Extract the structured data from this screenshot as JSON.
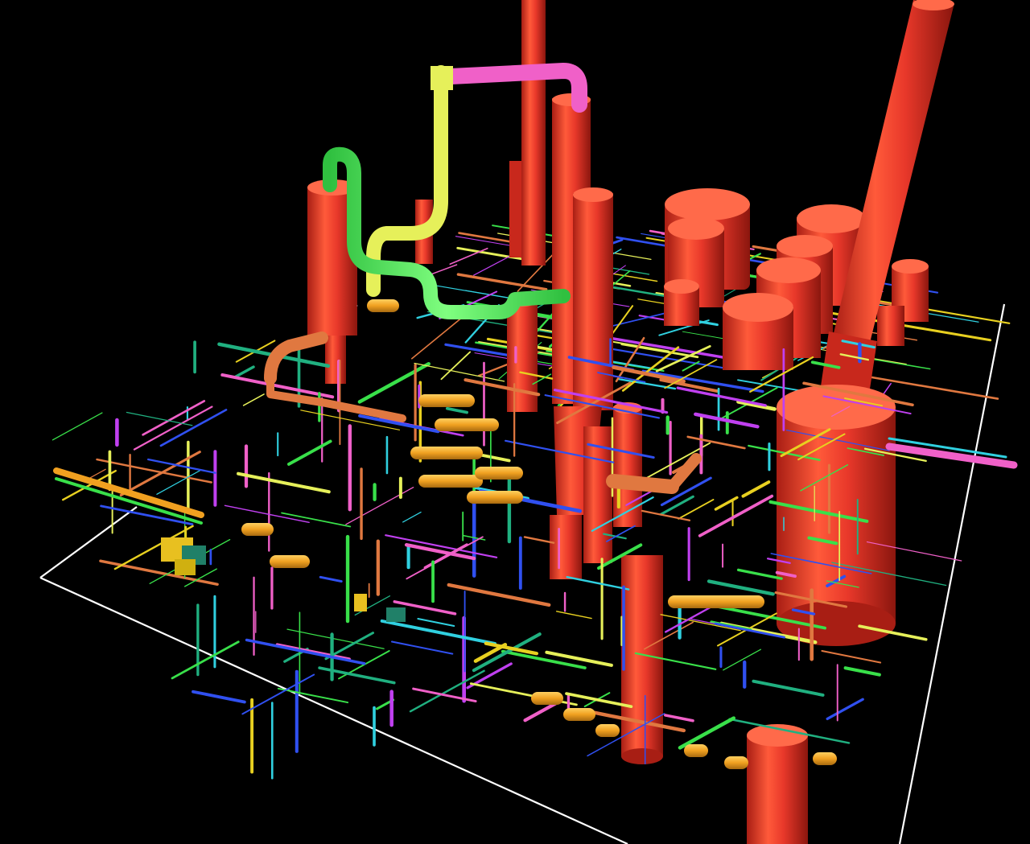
{
  "scene": {
    "subject": "3d-plant-piping-model",
    "palette": {
      "background": "#000000",
      "vessel": "#e8382a",
      "vessel_shade": "#a81e14",
      "vessel_highlight": "#ff6a4a",
      "exchanger": "#f0a020",
      "pipe_green": "#39e04a",
      "pipe_lime": "#e6f05a",
      "pipe_pink": "#f060c8",
      "pipe_magenta": "#c040f0",
      "pipe_cyan": "#30d0e0",
      "pipe_blue": "#3050f0",
      "pipe_yellow": "#e8d020",
      "pipe_orange": "#e07840",
      "pipe_teal": "#20b080",
      "grid_line": "#ffffff"
    }
  }
}
